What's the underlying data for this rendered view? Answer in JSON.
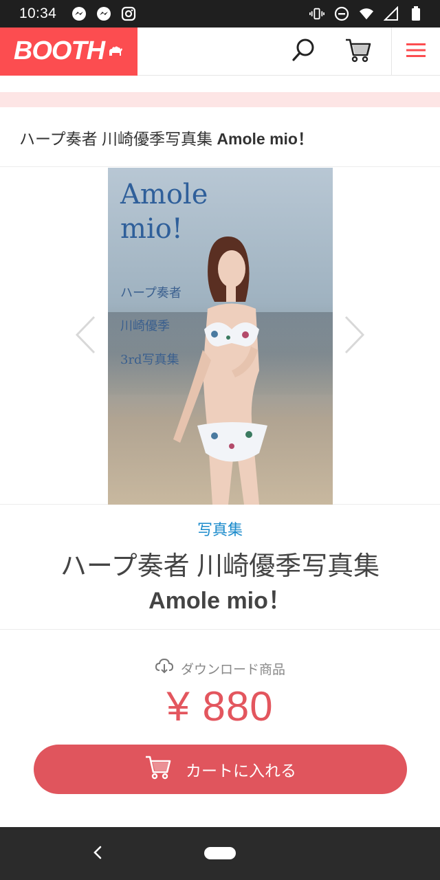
{
  "status_bar": {
    "time": "10:34",
    "left_icons": [
      "messenger-icon",
      "messenger-icon",
      "instagram-icon"
    ],
    "right_icons": [
      "vibrate-icon",
      "do-not-disturb-icon",
      "wifi-icon",
      "signal-icon",
      "battery-icon"
    ]
  },
  "header": {
    "logo_text": "BOOTH",
    "logo_color": "#fc4d50",
    "icons": [
      "search-icon",
      "cart-icon",
      "menu-icon"
    ]
  },
  "breadcrumb": {
    "title_jp": "ハープ奏者 川崎優季写真集 ",
    "title_en": "Amole mio！"
  },
  "gallery": {
    "cover_title_line1": "Amole",
    "cover_title_line2": "mio!",
    "cover_sub1": "ハープ奏者",
    "cover_sub2": "川崎優季",
    "cover_sub3": "3rd写真集"
  },
  "product": {
    "category": "写真集",
    "title_jp": "ハープ奏者 川崎優季写真集",
    "title_en": "Amole mio！"
  },
  "purchase": {
    "download_label": "ダウンロード商品",
    "price": "¥ 880",
    "cart_button_label": "カートに入れる",
    "accent_color": "#e0555d"
  }
}
